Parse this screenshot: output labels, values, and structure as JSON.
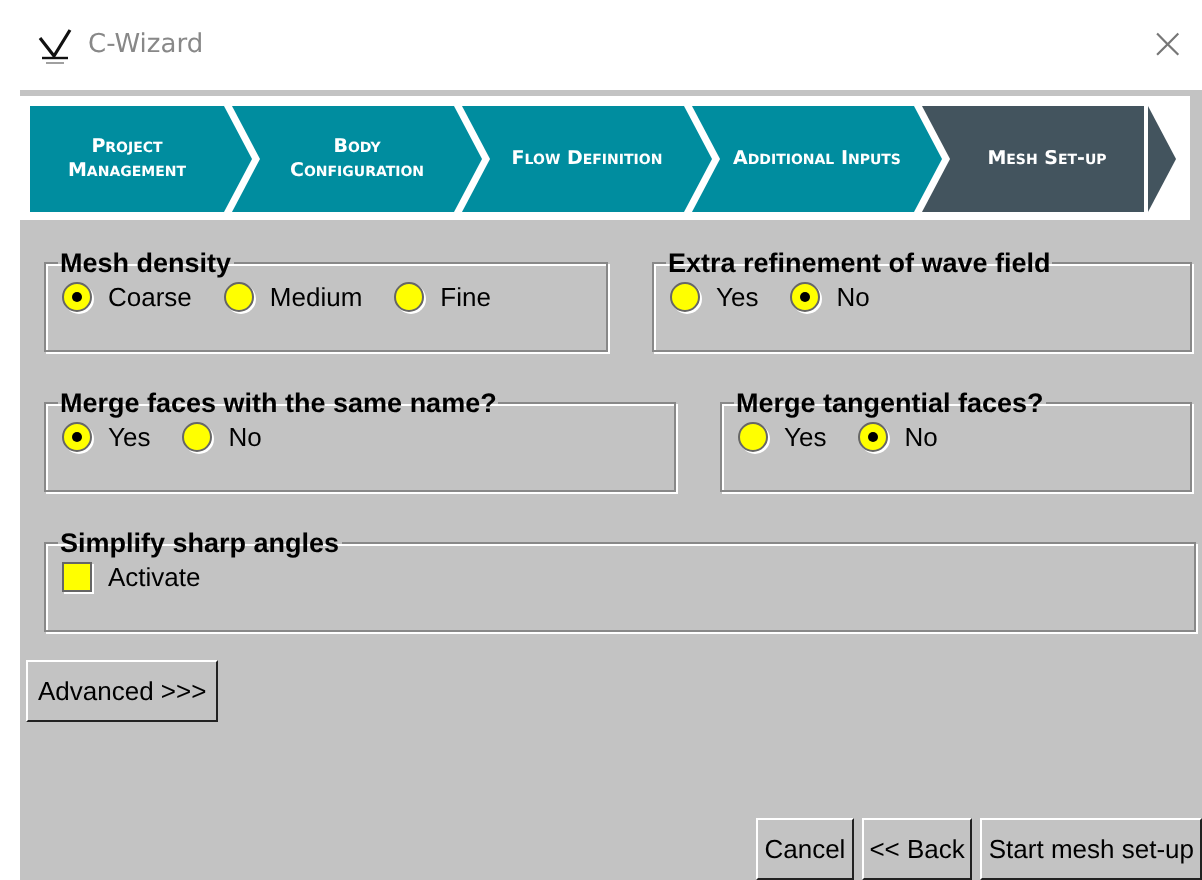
{
  "window": {
    "title": "C-Wizard",
    "close": "×"
  },
  "steps": [
    {
      "label": "Project Management",
      "selected": false
    },
    {
      "label": "Body Configuration",
      "selected": false
    },
    {
      "label": "Flow Definition",
      "selected": false
    },
    {
      "label": "Additional Inputs",
      "selected": false
    },
    {
      "label": "Mesh Set-up",
      "selected": true
    }
  ],
  "rows": [
    [
      {
        "title": "Mesh density",
        "kind": "radio",
        "options": [
          {
            "label": "Coarse",
            "selected": true
          },
          {
            "label": "Medium",
            "selected": false
          },
          {
            "label": "Fine",
            "selected": false
          }
        ]
      },
      {
        "title": "Extra refinement of wave field",
        "kind": "radio",
        "options": [
          {
            "label": "Yes",
            "selected": false
          },
          {
            "label": "No",
            "selected": true
          }
        ]
      }
    ],
    [
      {
        "title": "Merge faces with the same name?",
        "kind": "radio",
        "options": [
          {
            "label": "Yes",
            "selected": true
          },
          {
            "label": "No",
            "selected": false
          }
        ]
      },
      {
        "title": "Merge tangential faces?",
        "kind": "radio",
        "options": [
          {
            "label": "Yes",
            "selected": false
          },
          {
            "label": "No",
            "selected": true
          }
        ]
      }
    ],
    [
      {
        "title": "Simplify sharp angles",
        "kind": "checkbox",
        "options": [
          {
            "label": "Activate",
            "checked": false
          }
        ]
      }
    ]
  ],
  "advanced_button": "Advanced >>>",
  "buttons": [
    "Cancel",
    "<< Back",
    "Start mesh set-up"
  ]
}
